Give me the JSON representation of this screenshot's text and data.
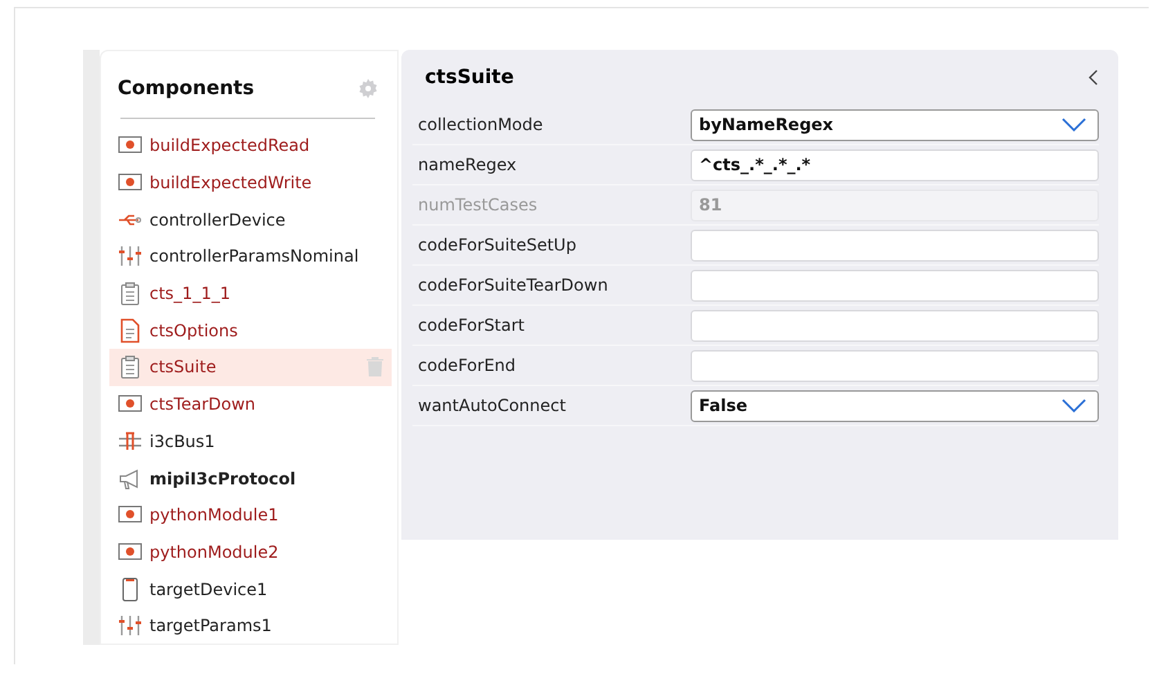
{
  "components": {
    "title": "Components",
    "items": [
      {
        "label": "buildExpectedRead",
        "kind": "module",
        "color": "#9e1b1b",
        "bold": false,
        "selected": false
      },
      {
        "label": "buildExpectedWrite",
        "kind": "module",
        "color": "#9e1b1b",
        "bold": false,
        "selected": false
      },
      {
        "label": "controllerDevice",
        "kind": "usb",
        "color": "#222222",
        "bold": false,
        "selected": false
      },
      {
        "label": "controllerParamsNominal",
        "kind": "sliders",
        "color": "#222222",
        "bold": false,
        "selected": false
      },
      {
        "label": "cts_1_1_1",
        "kind": "clipboard",
        "color": "#9e1b1b",
        "bold": false,
        "selected": false
      },
      {
        "label": "ctsOptions",
        "kind": "document",
        "color": "#9e1b1b",
        "bold": false,
        "selected": false
      },
      {
        "label": "ctsSuite",
        "kind": "clipboard",
        "color": "#9e1b1b",
        "bold": false,
        "selected": true
      },
      {
        "label": "ctsTearDown",
        "kind": "module",
        "color": "#9e1b1b",
        "bold": false,
        "selected": false
      },
      {
        "label": "i3cBus1",
        "kind": "bus",
        "color": "#222222",
        "bold": false,
        "selected": false
      },
      {
        "label": "mipiI3cProtocol",
        "kind": "megaphone",
        "color": "#222222",
        "bold": true,
        "selected": false
      },
      {
        "label": "pythonModule1",
        "kind": "module",
        "color": "#9e1b1b",
        "bold": false,
        "selected": false
      },
      {
        "label": "pythonModule2",
        "kind": "module",
        "color": "#9e1b1b",
        "bold": false,
        "selected": false
      },
      {
        "label": "targetDevice1",
        "kind": "device",
        "color": "#222222",
        "bold": false,
        "selected": false
      },
      {
        "label": "targetParams1",
        "kind": "sliders",
        "color": "#222222",
        "bold": false,
        "selected": false
      }
    ]
  },
  "properties": {
    "title": "ctsSuite",
    "rows": [
      {
        "label": "collectionMode",
        "kind": "dropdown",
        "value": "byNameRegex",
        "disabled": false
      },
      {
        "label": "nameRegex",
        "kind": "text",
        "value": "^cts_.*_.*_.*",
        "disabled": false
      },
      {
        "label": "numTestCases",
        "kind": "text",
        "value": "81",
        "disabled": true
      },
      {
        "label": "codeForSuiteSetUp",
        "kind": "text",
        "disabled": false
      },
      {
        "label": "codeForSuiteTearDown",
        "kind": "text",
        "disabled": false
      },
      {
        "label": "codeForStart",
        "kind": "text",
        "disabled": false
      },
      {
        "label": "codeForEnd",
        "kind": "text",
        "disabled": false
      },
      {
        "label": "wantAutoConnect",
        "kind": "dropdown",
        "value": "False",
        "disabled": false
      }
    ]
  }
}
